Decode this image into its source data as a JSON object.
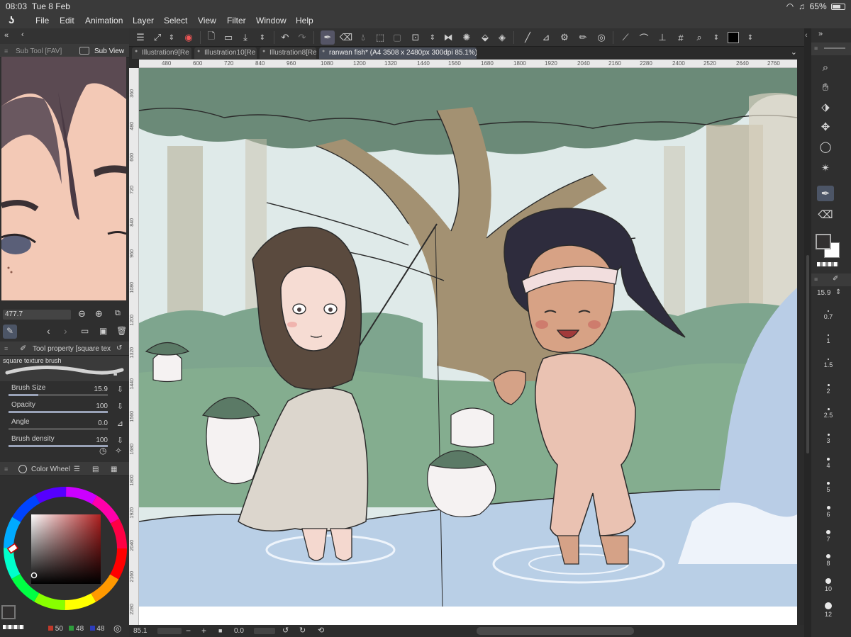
{
  "status": {
    "time": "08:03",
    "date": "Tue 8 Feb",
    "battery": "65%"
  },
  "menu": [
    "File",
    "Edit",
    "Animation",
    "Layer",
    "Select",
    "View",
    "Filter",
    "Window",
    "Help"
  ],
  "tabs": [
    {
      "label": "Illustration9[Re"
    },
    {
      "label": "Illustration10[Re"
    },
    {
      "label": "Illustration8[Re"
    },
    {
      "label": "ranwan fish* (A4 3508 x 2480px 300dpi 85.1%)"
    }
  ],
  "ruler_top": [
    "480",
    "600",
    "720",
    "840",
    "960",
    "1080",
    "1200",
    "1320",
    "1440",
    "1560",
    "1680",
    "1800",
    "1920",
    "2040",
    "2160",
    "2280",
    "2400",
    "2520",
    "2640",
    "2760"
  ],
  "ruler_left": [
    "360",
    "480",
    "600",
    "720",
    "840",
    "960",
    "1080",
    "1200",
    "1320",
    "1440",
    "1560",
    "1680",
    "1800",
    "1920",
    "2040",
    "2160",
    "2280"
  ],
  "sub_view": {
    "tab_subtool": "Sub Tool [FAV]",
    "tab_subview": "Sub View",
    "zoom": "477.7"
  },
  "tool_property": {
    "title": "Tool property [square textu",
    "brush_name": "square texture brush",
    "rows": [
      {
        "label": "Brush Size",
        "value": "15.9"
      },
      {
        "label": "Opacity",
        "value": "100"
      },
      {
        "label": "Angle",
        "value": "0.0"
      },
      {
        "label": "Brush density",
        "value": "100"
      }
    ]
  },
  "color_wheel": {
    "title": "Color Wheel",
    "r": "50",
    "g": "48",
    "b": "48",
    "accent": "#b02020"
  },
  "canvas_status": {
    "zoom": "85.1",
    "rotation": "0.0"
  },
  "right_panel": {
    "brush_size": "15.9",
    "sizes": [
      "0.7",
      "1",
      "1.5",
      "2",
      "2.5",
      "3",
      "4",
      "5",
      "6",
      "7",
      "8",
      "10",
      "12"
    ]
  }
}
